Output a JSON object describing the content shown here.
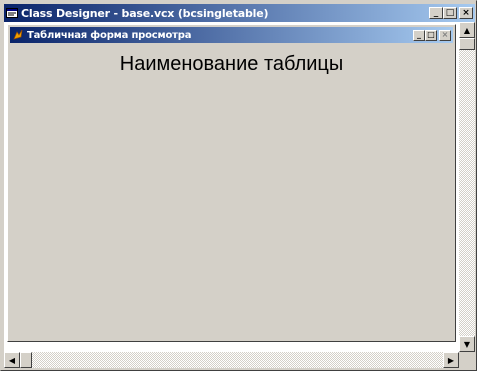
{
  "window": {
    "title": "Class Designer - base.vcx (bcsingletable)",
    "icon": "class-designer-icon"
  },
  "form": {
    "title": "Табличная форма просмотра",
    "icon": "fox-form-icon",
    "label": "Наименование таблицы"
  },
  "controls": {
    "minimize": "_",
    "maximize": "□",
    "close": "×"
  },
  "scroll": {
    "up": "▲",
    "down": "▼",
    "left": "◀",
    "right": "▶"
  },
  "colors": {
    "titlebar_start": "#0a246a",
    "titlebar_end": "#a6caf0",
    "face": "#d4d0c8"
  }
}
